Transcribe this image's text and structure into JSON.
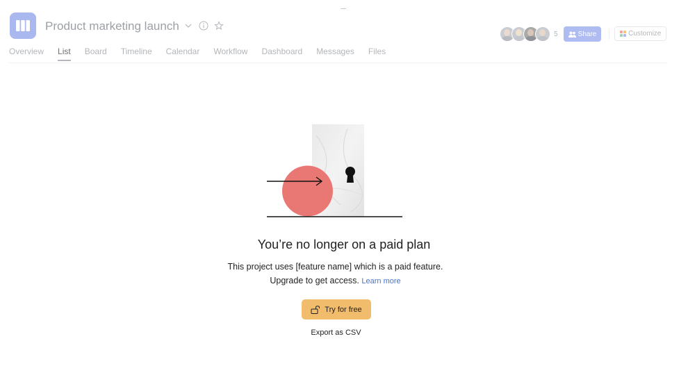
{
  "header": {
    "project_title": "Product marketing launch",
    "icons": {
      "project": "map-icon",
      "dropdown": "chevron-down-icon",
      "info": "info-icon",
      "favorite": "star-icon"
    },
    "member_count": "5",
    "share_label": "Share",
    "customize_label": "Customize",
    "colors": {
      "project_icon_bg": "#aab8f0",
      "share_bg": "#aebcf2"
    }
  },
  "tabs": [
    {
      "label": "Overview",
      "active": false
    },
    {
      "label": "List",
      "active": true
    },
    {
      "label": "Board",
      "active": false
    },
    {
      "label": "Timeline",
      "active": false
    },
    {
      "label": "Calendar",
      "active": false
    },
    {
      "label": "Workflow",
      "active": false
    },
    {
      "label": "Dashboard",
      "active": false
    },
    {
      "label": "Messages",
      "active": false
    },
    {
      "label": "Files",
      "active": false
    }
  ],
  "empty_state": {
    "headline": "You’re no longer on a paid plan",
    "description_line1": "This project uses [feature name] which is a paid feature.",
    "description_line2": "Upgrade to get access.",
    "learn_more": "Learn more",
    "try_button": "Try for free",
    "export_link": "Export as CSV",
    "colors": {
      "circle": "#e8746f",
      "try_button_bg": "#f1bd6c",
      "link": "#4573d2"
    }
  }
}
